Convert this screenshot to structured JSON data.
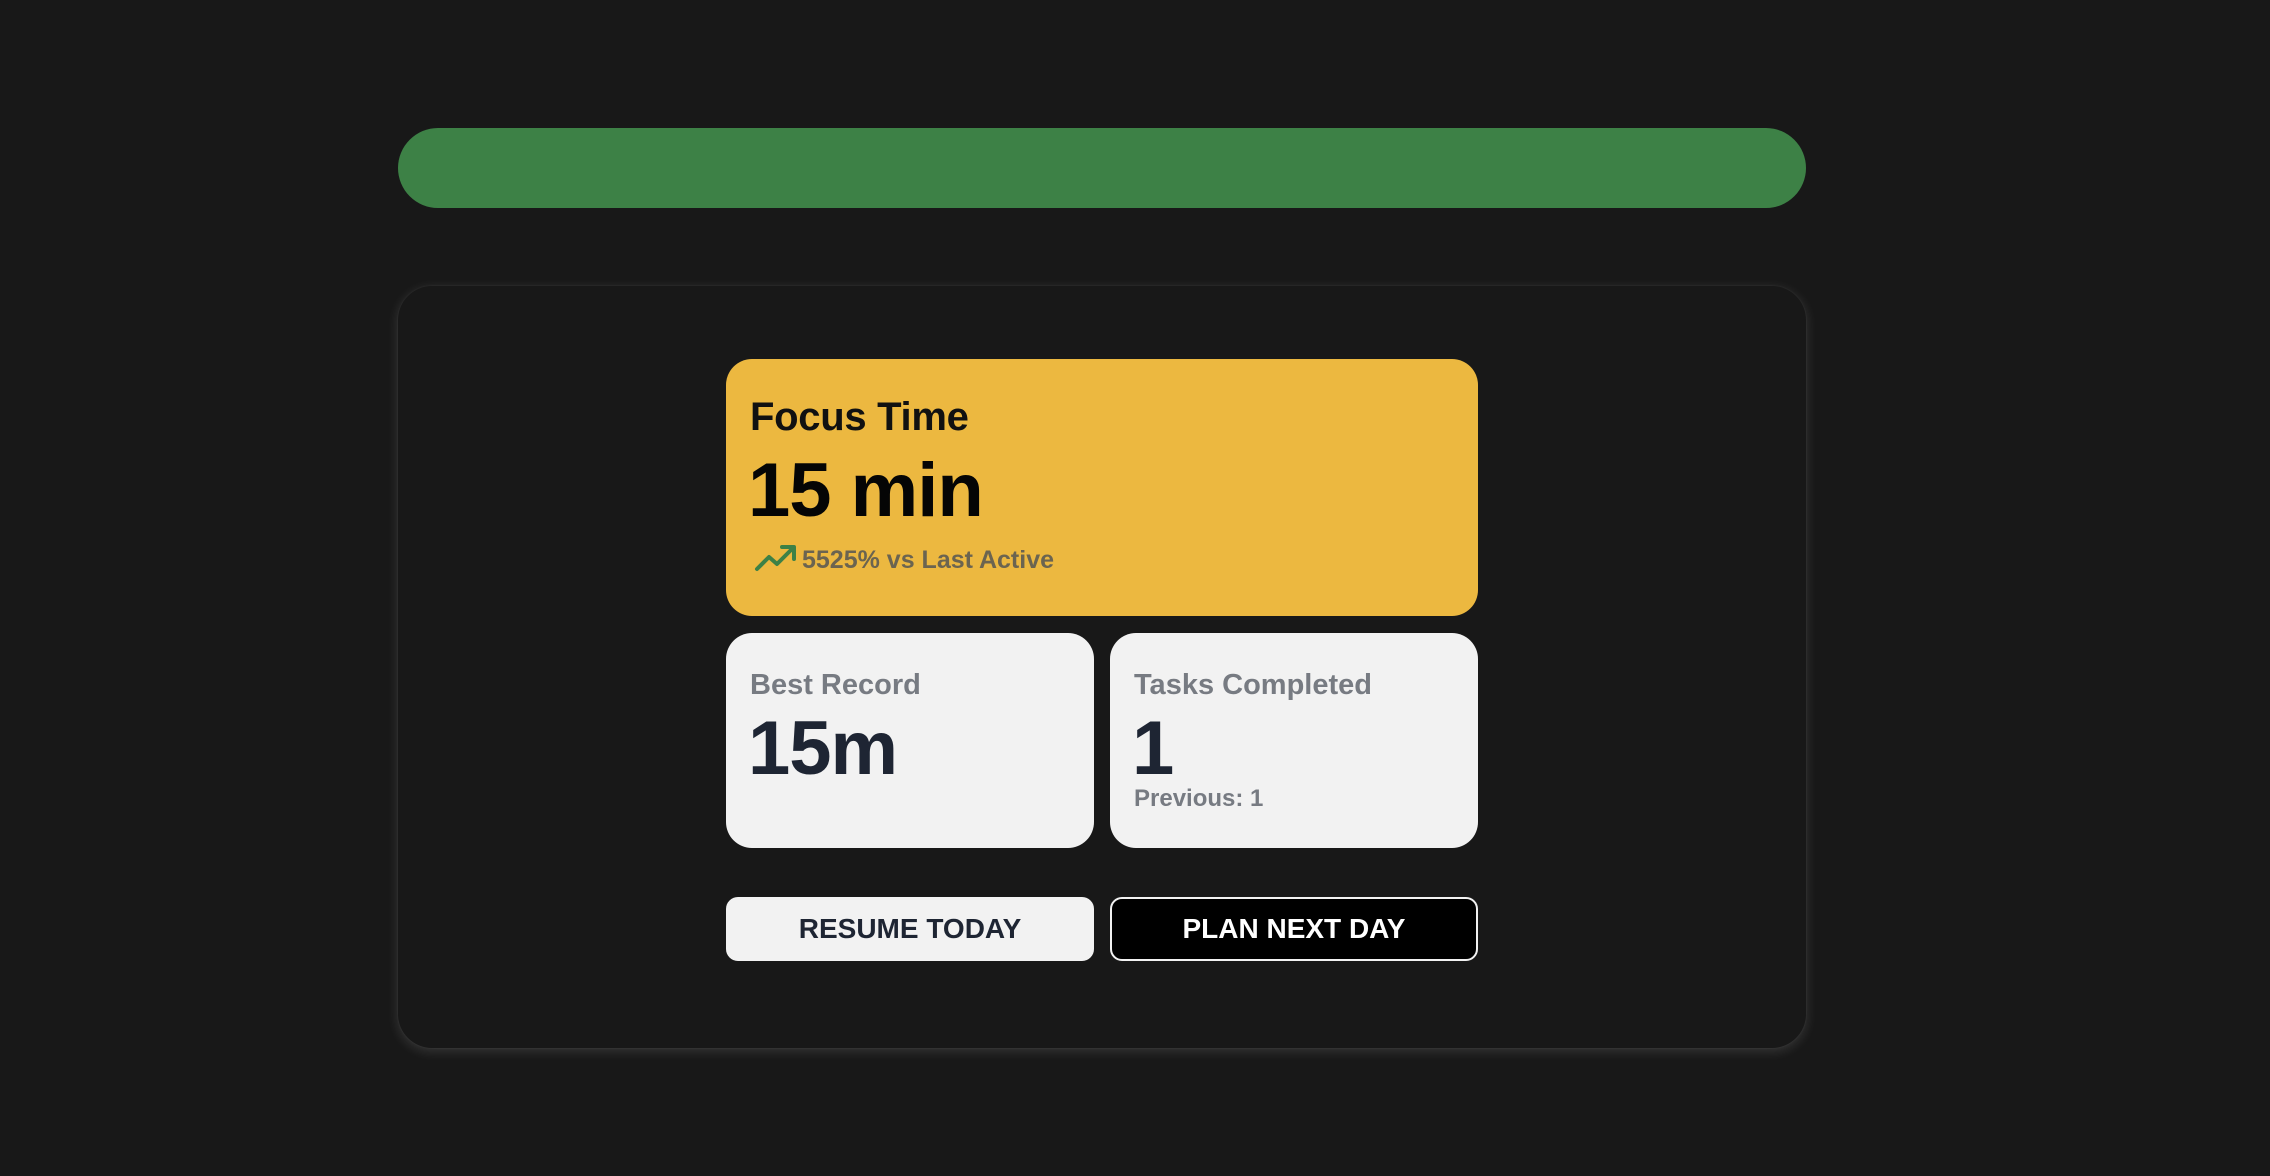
{
  "colors": {
    "background": "#181818",
    "banner": "#3d8146",
    "focus_card": "#ecb840",
    "stat_card": "#f2f2f2",
    "trend_up": "#3d8146"
  },
  "focus": {
    "label": "Focus Time",
    "value": "15 min",
    "trend_icon": "trending-up-icon",
    "trend_text": "5525% vs Last Active"
  },
  "best_record": {
    "label": "Best Record",
    "value": "15m"
  },
  "tasks": {
    "label": "Tasks Completed",
    "value": "1",
    "previous": "Previous: 1"
  },
  "actions": {
    "resume_label": "RESUME TODAY",
    "plan_label": "PLAN NEXT DAY"
  }
}
